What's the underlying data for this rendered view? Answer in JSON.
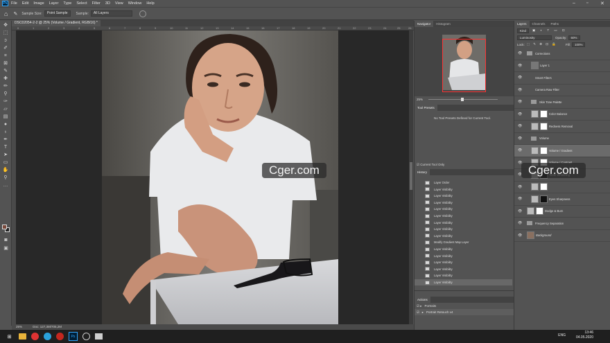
{
  "menubar": {
    "logo": "Ps",
    "items": [
      "File",
      "Edit",
      "Image",
      "Layer",
      "Type",
      "Select",
      "Filter",
      "3D",
      "View",
      "Window",
      "Help"
    ]
  },
  "options": {
    "sample_size_label": "Sample Size:",
    "sample_size_value": "Point Sample",
    "sample_label": "Sample:",
    "sample_value": "All Layers"
  },
  "document": {
    "tab_title": "DSC02054-2-2 @ 25% (Volume / Gradient, RGB/16) *",
    "ruler_marks": [
      "0",
      "1",
      "2",
      "3",
      "4",
      "5",
      "6",
      "7",
      "8",
      "9",
      "10",
      "11",
      "12",
      "13",
      "14",
      "15",
      "16",
      "17",
      "18",
      "19",
      "20",
      "21",
      "22",
      "23",
      "24",
      "25",
      "26"
    ],
    "status_zoom": "25%",
    "status_doc": "Doc: 127,3M/705,2M"
  },
  "navigator": {
    "tabs": [
      "Navigator",
      "Histogram"
    ],
    "zoom": "25%"
  },
  "tool_presets": {
    "title": "Tool Presets",
    "message": "No Tool Presets Defined for Current Tool.",
    "current_tool_only": "Current Tool Only"
  },
  "history": {
    "title": "History",
    "items": [
      {
        "label": "Layer Order",
        "selected": false
      },
      {
        "label": "Layer Visibility",
        "selected": false
      },
      {
        "label": "Layer Visibility",
        "selected": false
      },
      {
        "label": "Layer Visibility",
        "selected": false
      },
      {
        "label": "Layer Visibility",
        "selected": false
      },
      {
        "label": "Layer Visibility",
        "selected": false
      },
      {
        "label": "Layer Visibility",
        "selected": false
      },
      {
        "label": "Layer Visibility",
        "selected": false
      },
      {
        "label": "Layer Visibility",
        "selected": false
      },
      {
        "label": "Modify Gradient Map Layer",
        "selected": false
      },
      {
        "label": "Layer Visibility",
        "selected": false
      },
      {
        "label": "Layer Visibility",
        "selected": false
      },
      {
        "label": "Layer Visibility",
        "selected": false
      },
      {
        "label": "Layer Visibility",
        "selected": false
      },
      {
        "label": "Layer Visibility",
        "selected": false
      },
      {
        "label": "Layer Visibility",
        "selected": true
      }
    ]
  },
  "actions": {
    "title": "Actions",
    "items": [
      "Portraits",
      "Portrait Retouch v4"
    ]
  },
  "layers": {
    "tabs": [
      "Layers",
      "Channels",
      "Paths"
    ],
    "kind": "Kind",
    "blend": "Luminosity",
    "opacity_label": "Opacity:",
    "opacity": "60%",
    "lock_label": "Lock:",
    "fill_label": "Fill:",
    "fill": "100%",
    "items": [
      {
        "name": "Corrections",
        "type": "group",
        "indent": 0,
        "selected": false
      },
      {
        "name": "Layer 1",
        "type": "smart",
        "indent": 1,
        "selected": false
      },
      {
        "name": "Smart Filters",
        "type": "filter",
        "indent": 2,
        "selected": false
      },
      {
        "name": "Camera Raw Filter",
        "type": "filter",
        "indent": 2,
        "selected": false
      },
      {
        "name": "Skin Tone Palette",
        "type": "group",
        "indent": 1,
        "selected": false
      },
      {
        "name": "Color Balance",
        "type": "adjust",
        "indent": 1,
        "selected": false
      },
      {
        "name": "Redness Removal",
        "type": "adjust",
        "indent": 1,
        "selected": false
      },
      {
        "name": "Volume",
        "type": "group",
        "indent": 1,
        "selected": false
      },
      {
        "name": "Volume / Gradient",
        "type": "adjust",
        "indent": 1,
        "selected": true
      },
      {
        "name": "Volume / Contrast",
        "type": "adjust",
        "indent": 1,
        "selected": false
      },
      {
        "name": "Tooth Whitening",
        "type": "adjust",
        "indent": 1,
        "selected": false
      },
      {
        "name": "",
        "type": "adjust",
        "indent": 1,
        "selected": false
      },
      {
        "name": "Eyes Sharpness",
        "type": "adjust",
        "indent": 1,
        "selected": false
      },
      {
        "name": "Dodge & Burn",
        "type": "adjust",
        "indent": 0,
        "selected": false
      },
      {
        "name": "Frequency Separation",
        "type": "group",
        "indent": 0,
        "selected": false
      },
      {
        "name": "Background",
        "type": "bg",
        "indent": 0,
        "selected": false
      }
    ]
  },
  "watermark": "Cger.com",
  "taskbar": {
    "lang": "ENG",
    "time": "13:46",
    "date": "04.05.2020"
  },
  "colors": {
    "ui_bg": "#535353",
    "panel_dark": "#424242",
    "canvas_bg": "#282828",
    "selection": "#6b6b6b",
    "nav_box": "#ff3333",
    "ps_blue": "#31a8ff"
  }
}
